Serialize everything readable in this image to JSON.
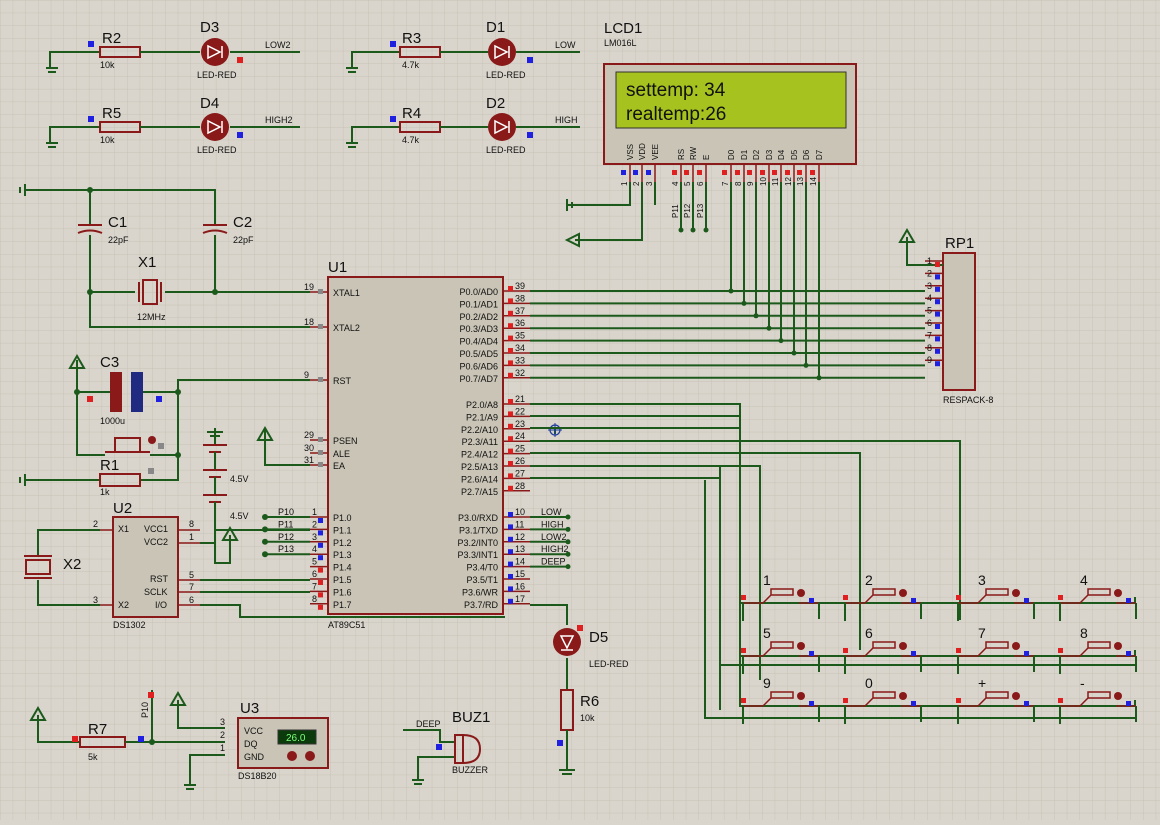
{
  "colors": {
    "background": "#d9d5cc",
    "grid": "#c8c4bb",
    "wire": "#1c5a1c",
    "component": "#8a1a1a",
    "lcd_screen": "#a6c21e",
    "pin_high": "#e02020",
    "pin_low": "#2020e0"
  },
  "lcd": {
    "ref": "LCD1",
    "part": "LM016L",
    "line1": "settemp: 34",
    "line2": "realtemp:26",
    "pins": [
      "VSS",
      "VDD",
      "VEE",
      "RS",
      "RW",
      "E",
      "D0",
      "D1",
      "D2",
      "D3",
      "D4",
      "D5",
      "D6",
      "D7"
    ],
    "pin_numbers": [
      "1",
      "2",
      "3",
      "4",
      "5",
      "6",
      "7",
      "8",
      "9",
      "10",
      "11",
      "12",
      "13",
      "14"
    ],
    "ctrl_nets": [
      "P11",
      "P12",
      "P13"
    ]
  },
  "leds": [
    {
      "ref": "D3",
      "value": "LED-RED",
      "net": "LOW2",
      "res_ref": "R2",
      "res_val": "10k"
    },
    {
      "ref": "D1",
      "value": "LED-RED",
      "net": "LOW",
      "res_ref": "R3",
      "res_val": "4.7k"
    },
    {
      "ref": "D4",
      "value": "LED-RED",
      "net": "HIGH2",
      "res_ref": "R5",
      "res_val": "10k"
    },
    {
      "ref": "D2",
      "value": "LED-RED",
      "net": "HIGH",
      "res_ref": "R4",
      "res_val": "4.7k"
    }
  ],
  "caps": {
    "c1": "C1",
    "c1v": "22pF",
    "c2": "C2",
    "c2v": "22pF",
    "c3": "C3",
    "c3v": "1000u"
  },
  "crystal": {
    "x1": "X1",
    "x1v": "12MHz",
    "x2": "X2"
  },
  "r1": {
    "ref": "R1",
    "value": "1k"
  },
  "r6": {
    "ref": "R6",
    "value": "10k"
  },
  "r7": {
    "ref": "R7",
    "value": "5k"
  },
  "d5": {
    "ref": "D5",
    "value": "LED-RED"
  },
  "buz": {
    "ref": "BUZ1",
    "value": "BUZZER",
    "net": "DEEP"
  },
  "batt": {
    "v1": "4.5V",
    "v2": "4.5V"
  },
  "mcu": {
    "ref": "U1",
    "part": "AT89C51",
    "left_pins": [
      {
        "n": "19",
        "l": "XTAL1"
      },
      {
        "n": "18",
        "l": "XTAL2"
      },
      {
        "n": "9",
        "l": "RST"
      },
      {
        "n": "29",
        "l": "PSEN"
      },
      {
        "n": "30",
        "l": "ALE"
      },
      {
        "n": "31",
        "l": "EA"
      }
    ],
    "p1": [
      {
        "n": "1",
        "l": "P1.0",
        "net": "P10"
      },
      {
        "n": "2",
        "l": "P1.1",
        "net": "P11"
      },
      {
        "n": "3",
        "l": "P1.2",
        "net": "P12"
      },
      {
        "n": "4",
        "l": "P1.3",
        "net": "P13"
      },
      {
        "n": "5",
        "l": "P1.4",
        "net": ""
      },
      {
        "n": "6",
        "l": "P1.5",
        "net": ""
      },
      {
        "n": "7",
        "l": "P1.6",
        "net": ""
      },
      {
        "n": "8",
        "l": "P1.7",
        "net": ""
      }
    ],
    "p0": [
      {
        "n": "39",
        "l": "P0.0/AD0"
      },
      {
        "n": "38",
        "l": "P0.1/AD1"
      },
      {
        "n": "37",
        "l": "P0.2/AD2"
      },
      {
        "n": "36",
        "l": "P0.3/AD3"
      },
      {
        "n": "35",
        "l": "P0.4/AD4"
      },
      {
        "n": "34",
        "l": "P0.5/AD5"
      },
      {
        "n": "33",
        "l": "P0.6/AD6"
      },
      {
        "n": "32",
        "l": "P0.7/AD7"
      }
    ],
    "p2": [
      {
        "n": "21",
        "l": "P2.0/A8"
      },
      {
        "n": "22",
        "l": "P2.1/A9"
      },
      {
        "n": "23",
        "l": "P2.2/A10"
      },
      {
        "n": "24",
        "l": "P2.3/A11"
      },
      {
        "n": "25",
        "l": "P2.4/A12"
      },
      {
        "n": "26",
        "l": "P2.5/A13"
      },
      {
        "n": "27",
        "l": "P2.6/A14"
      },
      {
        "n": "28",
        "l": "P2.7/A15"
      }
    ],
    "p3": [
      {
        "n": "10",
        "l": "P3.0/RXD",
        "net": "LOW"
      },
      {
        "n": "11",
        "l": "P3.1/TXD",
        "net": "HIGH"
      },
      {
        "n": "12",
        "l": "P3.2/INT0",
        "net": "LOW2"
      },
      {
        "n": "13",
        "l": "P3.3/INT1",
        "net": "HIGH2"
      },
      {
        "n": "14",
        "l": "P3.4/T0",
        "net": "DEEP"
      },
      {
        "n": "15",
        "l": "P3.5/T1",
        "net": ""
      },
      {
        "n": "16",
        "l": "P3.6/WR",
        "net": ""
      },
      {
        "n": "17",
        "l": "P3.7/RD",
        "net": ""
      }
    ]
  },
  "rp1": {
    "ref": "RP1",
    "part": "RESPACK-8",
    "pins": [
      "1",
      "2",
      "3",
      "4",
      "5",
      "6",
      "7",
      "8",
      "9"
    ]
  },
  "u2": {
    "ref": "U2",
    "part": "DS1302",
    "pins_left": [
      {
        "n": "2",
        "l": "X1"
      },
      {
        "n": "3",
        "l": "X2"
      }
    ],
    "pins_right": [
      {
        "n": "8",
        "l": "VCC1"
      },
      {
        "n": "1",
        "l": "VCC2"
      },
      {
        "n": "5",
        "l": "RST"
      },
      {
        "n": "7",
        "l": "SCLK"
      },
      {
        "n": "6",
        "l": "I/O"
      }
    ]
  },
  "u3": {
    "ref": "U3",
    "part": "DS18B20",
    "display": "26.0",
    "pins": [
      {
        "n": "3",
        "l": "VCC"
      },
      {
        "n": "2",
        "l": "DQ"
      },
      {
        "n": "1",
        "l": "GND"
      }
    ],
    "net": "P10"
  },
  "keys": [
    "1",
    "2",
    "3",
    "4",
    "5",
    "6",
    "7",
    "8",
    "9",
    "0",
    "+",
    "-"
  ]
}
